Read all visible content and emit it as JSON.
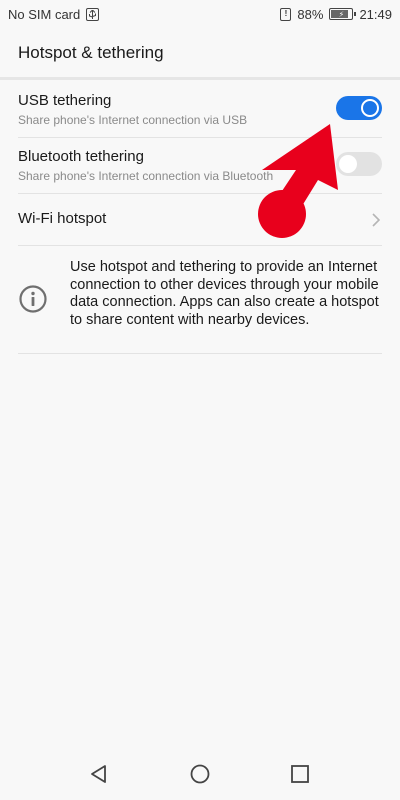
{
  "status_bar": {
    "carrier": "No SIM card",
    "battery_percent": "88%",
    "battery_level": 0.88,
    "time": "21:49",
    "icons": [
      "usb-icon",
      "sim-alert-icon",
      "battery-charging-icon"
    ]
  },
  "header": {
    "title": "Hotspot & tethering"
  },
  "settings": {
    "usb": {
      "title": "USB tethering",
      "subtitle": "Share phone's Internet connection via USB",
      "enabled": true
    },
    "bluetooth": {
      "title": "Bluetooth tethering",
      "subtitle": "Share phone's Internet connection via Bluetooth",
      "enabled": false
    },
    "wifi": {
      "title": "Wi-Fi hotspot"
    }
  },
  "info": {
    "text": "Use hotspot and tethering to provide an Internet connection to other devices through your mobile data connection. Apps can also create a hotspot to share content with nearby devices."
  },
  "colors": {
    "accent": "#1a75e8",
    "annotation": "#e8001c",
    "background": "#f8f8f8"
  },
  "nav_bar": {
    "icons": [
      "back-icon",
      "home-icon",
      "recents-icon"
    ]
  }
}
